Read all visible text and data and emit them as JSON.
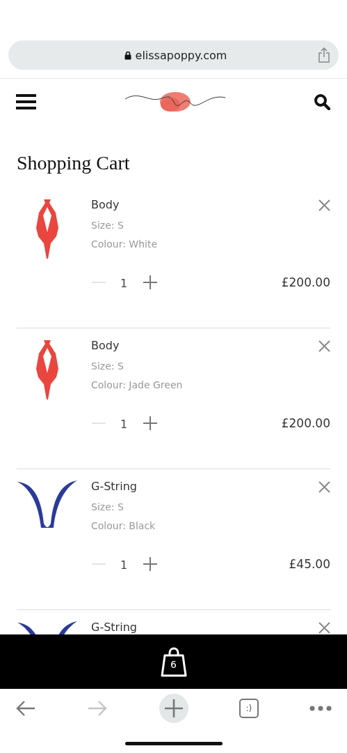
{
  "browser": {
    "address": "elissapoppy.com"
  },
  "page_title": "Shopping Cart",
  "cart_items": [
    {
      "name": "Body",
      "size": "Size: S",
      "colour": "Colour: White",
      "quantity": "1",
      "decrease_disabled": true,
      "price": "£200.00",
      "kind": "bodysuit",
      "color": "#e8463e"
    },
    {
      "name": "Body",
      "size": "Size: S",
      "colour": "Colour: Jade Green",
      "quantity": "1",
      "decrease_disabled": true,
      "price": "£200.00",
      "kind": "bodysuit",
      "color": "#e8463e"
    },
    {
      "name": "G-String",
      "size": "Size: S",
      "colour": "Colour: Black",
      "quantity": "1",
      "decrease_disabled": true,
      "price": "£45.00",
      "kind": "thong",
      "color": "#2a3a9a"
    },
    {
      "name": "G-String",
      "kind": "thong",
      "color": "#2a3a9a"
    }
  ],
  "cart_bar": {
    "count": "6"
  },
  "toolbar": {
    "back_disabled": false,
    "forward_disabled": true,
    "tabs_label": ":)"
  }
}
